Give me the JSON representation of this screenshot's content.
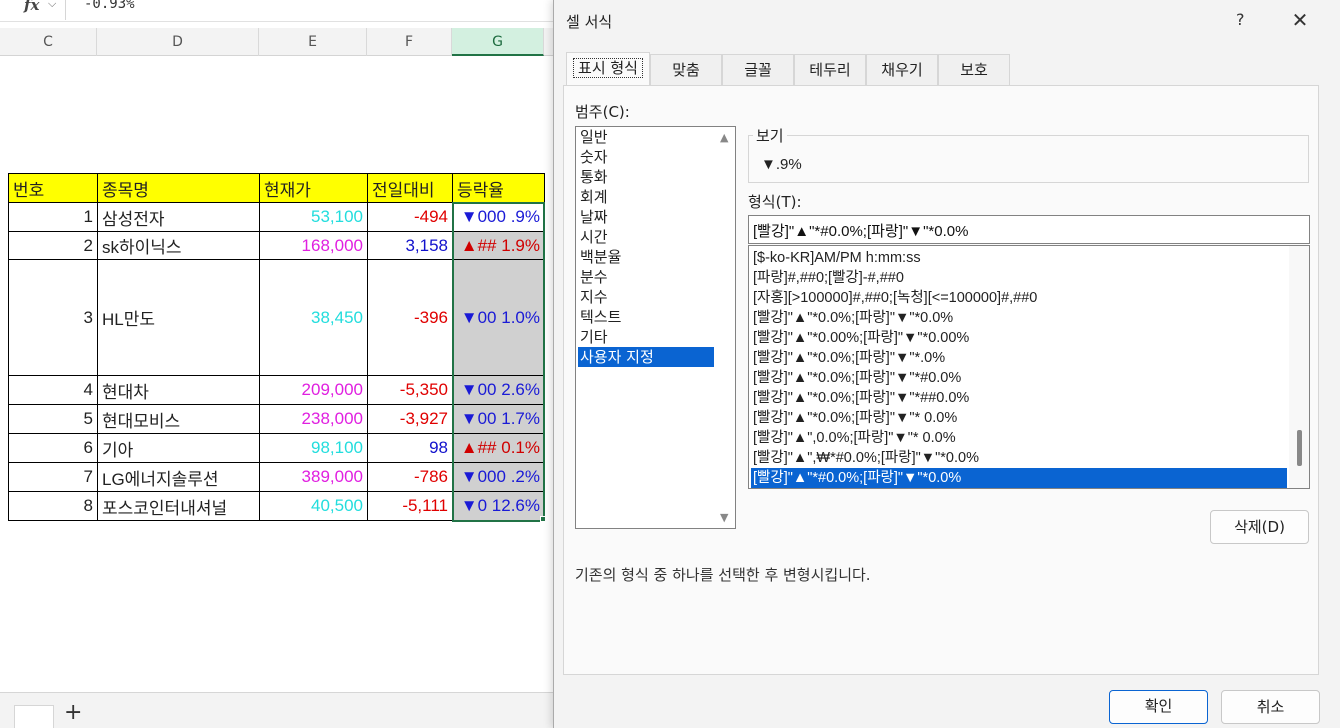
{
  "formula_bar": {
    "fx_label": "fx",
    "value": "-0.93%"
  },
  "columns": [
    "C",
    "D",
    "E",
    "F",
    "G"
  ],
  "table": {
    "headers": [
      "번호",
      "종목명",
      "현재가",
      "전일대비",
      "등락율"
    ],
    "rows": [
      {
        "no": "1",
        "name": "삼성전자",
        "price": "53,100",
        "change": "-494",
        "rate": "▼000 .9%"
      },
      {
        "no": "2",
        "name": "sk하이닉스",
        "price": "168,000",
        "change": "3,158",
        "rate": "▲## 1.9%"
      },
      {
        "no": "3",
        "name": "HL만도",
        "price": "38,450",
        "change": "-396",
        "rate": "▼00 1.0%"
      },
      {
        "no": "4",
        "name": "현대차",
        "price": "209,000",
        "change": "-5,350",
        "rate": "▼00 2.6%"
      },
      {
        "no": "5",
        "name": "현대모비스",
        "price": "238,000",
        "change": "-3,927",
        "rate": "▼00 1.7%"
      },
      {
        "no": "6",
        "name": "기아",
        "price": "98,100",
        "change": "98",
        "rate": "▲## 0.1%"
      },
      {
        "no": "7",
        "name": "LG에너지솔루션",
        "price": "389,000",
        "change": "-786",
        "rate": "▼000 .2%"
      },
      {
        "no": "8",
        "name": "포스코인터내셔널",
        "price": "40,500",
        "change": "-5,111",
        "rate": "▼0 12.6%"
      }
    ]
  },
  "sheet_tabs": {
    "add_label": "+"
  },
  "dialog": {
    "title": "셀 서식",
    "help": "?",
    "close": "✕",
    "tabs": [
      "표시 형식",
      "맞춤",
      "글꼴",
      "테두리",
      "채우기",
      "보호"
    ],
    "category_label": "범주(C):",
    "categories": [
      "일반",
      "숫자",
      "통화",
      "회계",
      "날짜",
      "시간",
      "백분율",
      "분수",
      "지수",
      "텍스트",
      "기타",
      "사용자 지정"
    ],
    "preview_label": "보기",
    "preview_value": "▼.9%",
    "format_label": "형식(T):",
    "format_value": "[빨강]\"▲\"*#0.0%;[파랑]\"▼\"*0.0%",
    "formats": [
      "[$-ko-KR]AM/PM h:mm:ss",
      "[파랑]#,##0;[빨강]-#,##0",
      "[자홍][>100000]#,##0;[녹청][<=100000]#,##0",
      "[빨강]\"▲\"*0.0%;[파랑]\"▼\"*0.0%",
      "[빨강]\"▲\"*0.00%;[파랑]\"▼\"*0.00%",
      "[빨강]\"▲\"*0.0%;[파랑]\"▼\"*.0%",
      "[빨강]\"▲\"*0.0%;[파랑]\"▼\"*#0.0%",
      "[빨강]\"▲\"*0.0%;[파랑]\"▼\"*##0.0%",
      "[빨강]\"▲\"*0.0%;[파랑]\"▼\"* 0.0%",
      "[빨강]\"▲\",0.0%;[파랑]\"▼\"* 0.0%",
      "[빨강]\"▲\",₩*#0.0%;[파랑]\"▼\"*0.0%",
      "[빨강]\"▲\"*#0.0%;[파랑]\"▼\"*0.0%"
    ],
    "delete_label": "삭제(D)",
    "description": "기존의 형식 중 하나를 선택한 후 변형시킵니다.",
    "ok_label": "확인",
    "cancel_label": "취소"
  },
  "colors": {
    "accent": "#0a64d2",
    "header_fill": "#ffff00",
    "selection": "#217346",
    "up": "#d00000",
    "down": "#1a1ad6"
  }
}
